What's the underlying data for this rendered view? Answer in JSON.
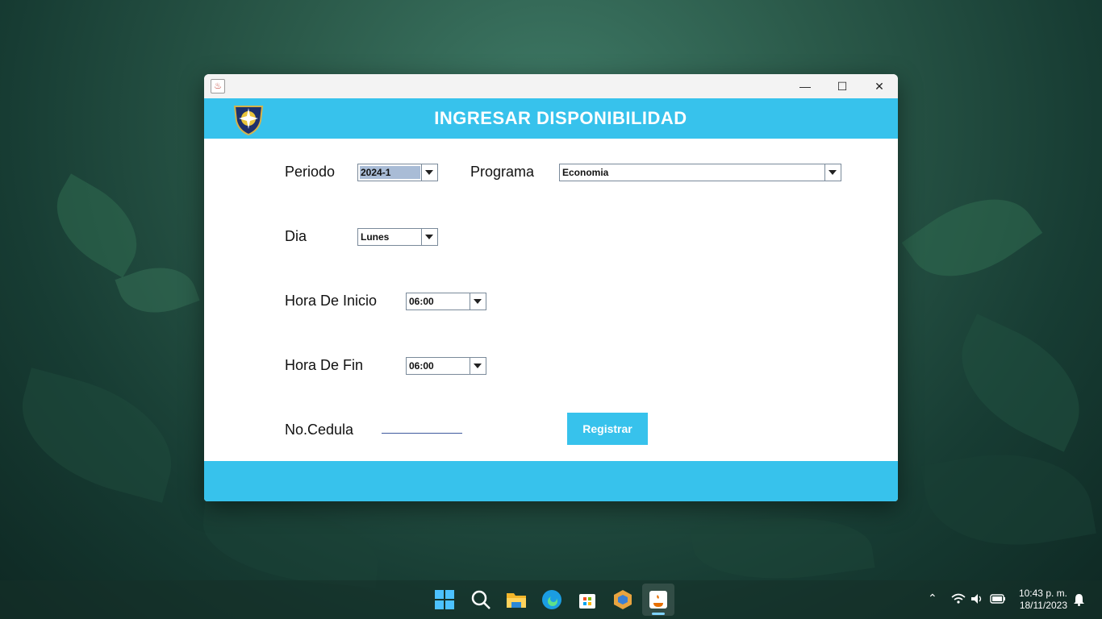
{
  "window": {
    "title": "",
    "icon": "java-cup-icon",
    "controls": {
      "minimize": "—",
      "maximize": "☐",
      "close": "✕"
    }
  },
  "header": {
    "title": "INGRESAR DISPONIBILIDAD",
    "logo": "shield-logo"
  },
  "form": {
    "periodo": {
      "label": "Periodo",
      "value": "2024-1"
    },
    "programa": {
      "label": "Programa",
      "value": "Economia"
    },
    "dia": {
      "label": "Dia",
      "value": "Lunes"
    },
    "hora_inicio": {
      "label": "Hora De Inicio",
      "value": "06:00"
    },
    "hora_fin": {
      "label": "Hora De Fin",
      "value": "06:00"
    },
    "cedula": {
      "label": "No.Cedula",
      "value": ""
    },
    "submit_label": "Registrar"
  },
  "colors": {
    "accent": "#37c2ec",
    "window_bg": "#ffffff"
  },
  "taskbar": {
    "apps": [
      "windows-start-icon",
      "search-icon",
      "file-explorer-icon",
      "edge-icon",
      "store-icon",
      "box-app-icon",
      "java-app-icon"
    ],
    "tray": [
      "chevron-up-icon",
      "wifi-icon",
      "volume-icon",
      "battery-icon",
      "bell-icon"
    ],
    "time": "10:43 p. m.",
    "date": "18/11/2023"
  }
}
